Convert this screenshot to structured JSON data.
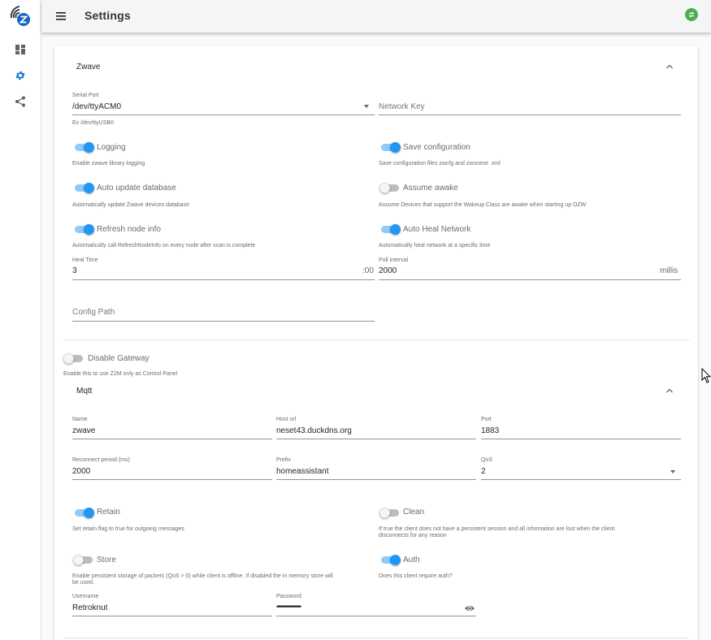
{
  "topbar": {
    "title": "Settings"
  },
  "zwave": {
    "section_title": "Zwave",
    "serial_port": {
      "label": "Serial Port",
      "value": "/dev/ttyACM0",
      "hint": "Ex /dev/ttyUSB0"
    },
    "network_key": {
      "placeholder": "Network Key"
    },
    "logging": {
      "label": "Logging",
      "hint": "Enable zwave library logging",
      "on": true
    },
    "save_configuration": {
      "label": "Save configuration",
      "hint": "Save configuration files zwcfg and zwscene .xml",
      "on": true
    },
    "auto_update_db": {
      "label": "Auto update database",
      "hint": "Automatically update Zwave devices database",
      "on": true
    },
    "assume_awake": {
      "label": "Assume awake",
      "hint": "Assume Devices that support the Wakeup Class are awake when starting up OZW",
      "on": false
    },
    "refresh_node_info": {
      "label": "Refresh node info",
      "hint": "Automatically call RefreshNodeInfo on every node after scan is complete",
      "on": true
    },
    "auto_heal": {
      "label": "Auto Heal Network",
      "hint": "Automatically heal network at a specific time",
      "on": true
    },
    "heal_time": {
      "label": "Heal Time",
      "value": "3",
      "suffix": ":00"
    },
    "poll_interval": {
      "label": "Poll interval",
      "value": "2000",
      "suffix": "millis"
    },
    "config_path": {
      "placeholder": "Config Path"
    }
  },
  "gateway": {
    "disable": {
      "label": "Disable Gateway",
      "hint": "Enable this to use Z2M only as Control Panel",
      "on": false
    }
  },
  "mqtt": {
    "section_title": "Mqtt",
    "name": {
      "label": "Name",
      "value": "zwave"
    },
    "host": {
      "label": "Host url",
      "value": "neset43.duckdns.org"
    },
    "port": {
      "label": "Port",
      "value": "1883"
    },
    "reconnect": {
      "label": "Reconnect period (ms)",
      "value": "2000"
    },
    "prefix": {
      "label": "Prefix",
      "value": "homeassistant"
    },
    "qos": {
      "label": "QoS",
      "value": "2"
    },
    "retain": {
      "label": "Retain",
      "hint": "Set retain flag to true for outgoing messages",
      "on": true
    },
    "clean": {
      "label": "Clean",
      "hint1": "If true the client does not have a persistent session and all information are lost when the client",
      "hint2": "disconnects for any reason",
      "on": false
    },
    "store": {
      "label": "Store",
      "hint1": "Enable persistent storage of packets (QoS > 0) while client is offline. If disabled the in memory store will",
      "hint2": "be used.",
      "on": false
    },
    "auth": {
      "label": "Auth",
      "hint": "Does this client require auth?",
      "on": true
    },
    "username": {
      "label": "Username",
      "value": "Retroknut"
    },
    "password": {
      "label": "Password",
      "value": "••••••••••••"
    }
  },
  "colors": {
    "accent": "#2196f3",
    "accent_track": "#90caf9",
    "status": "#4caf50"
  }
}
